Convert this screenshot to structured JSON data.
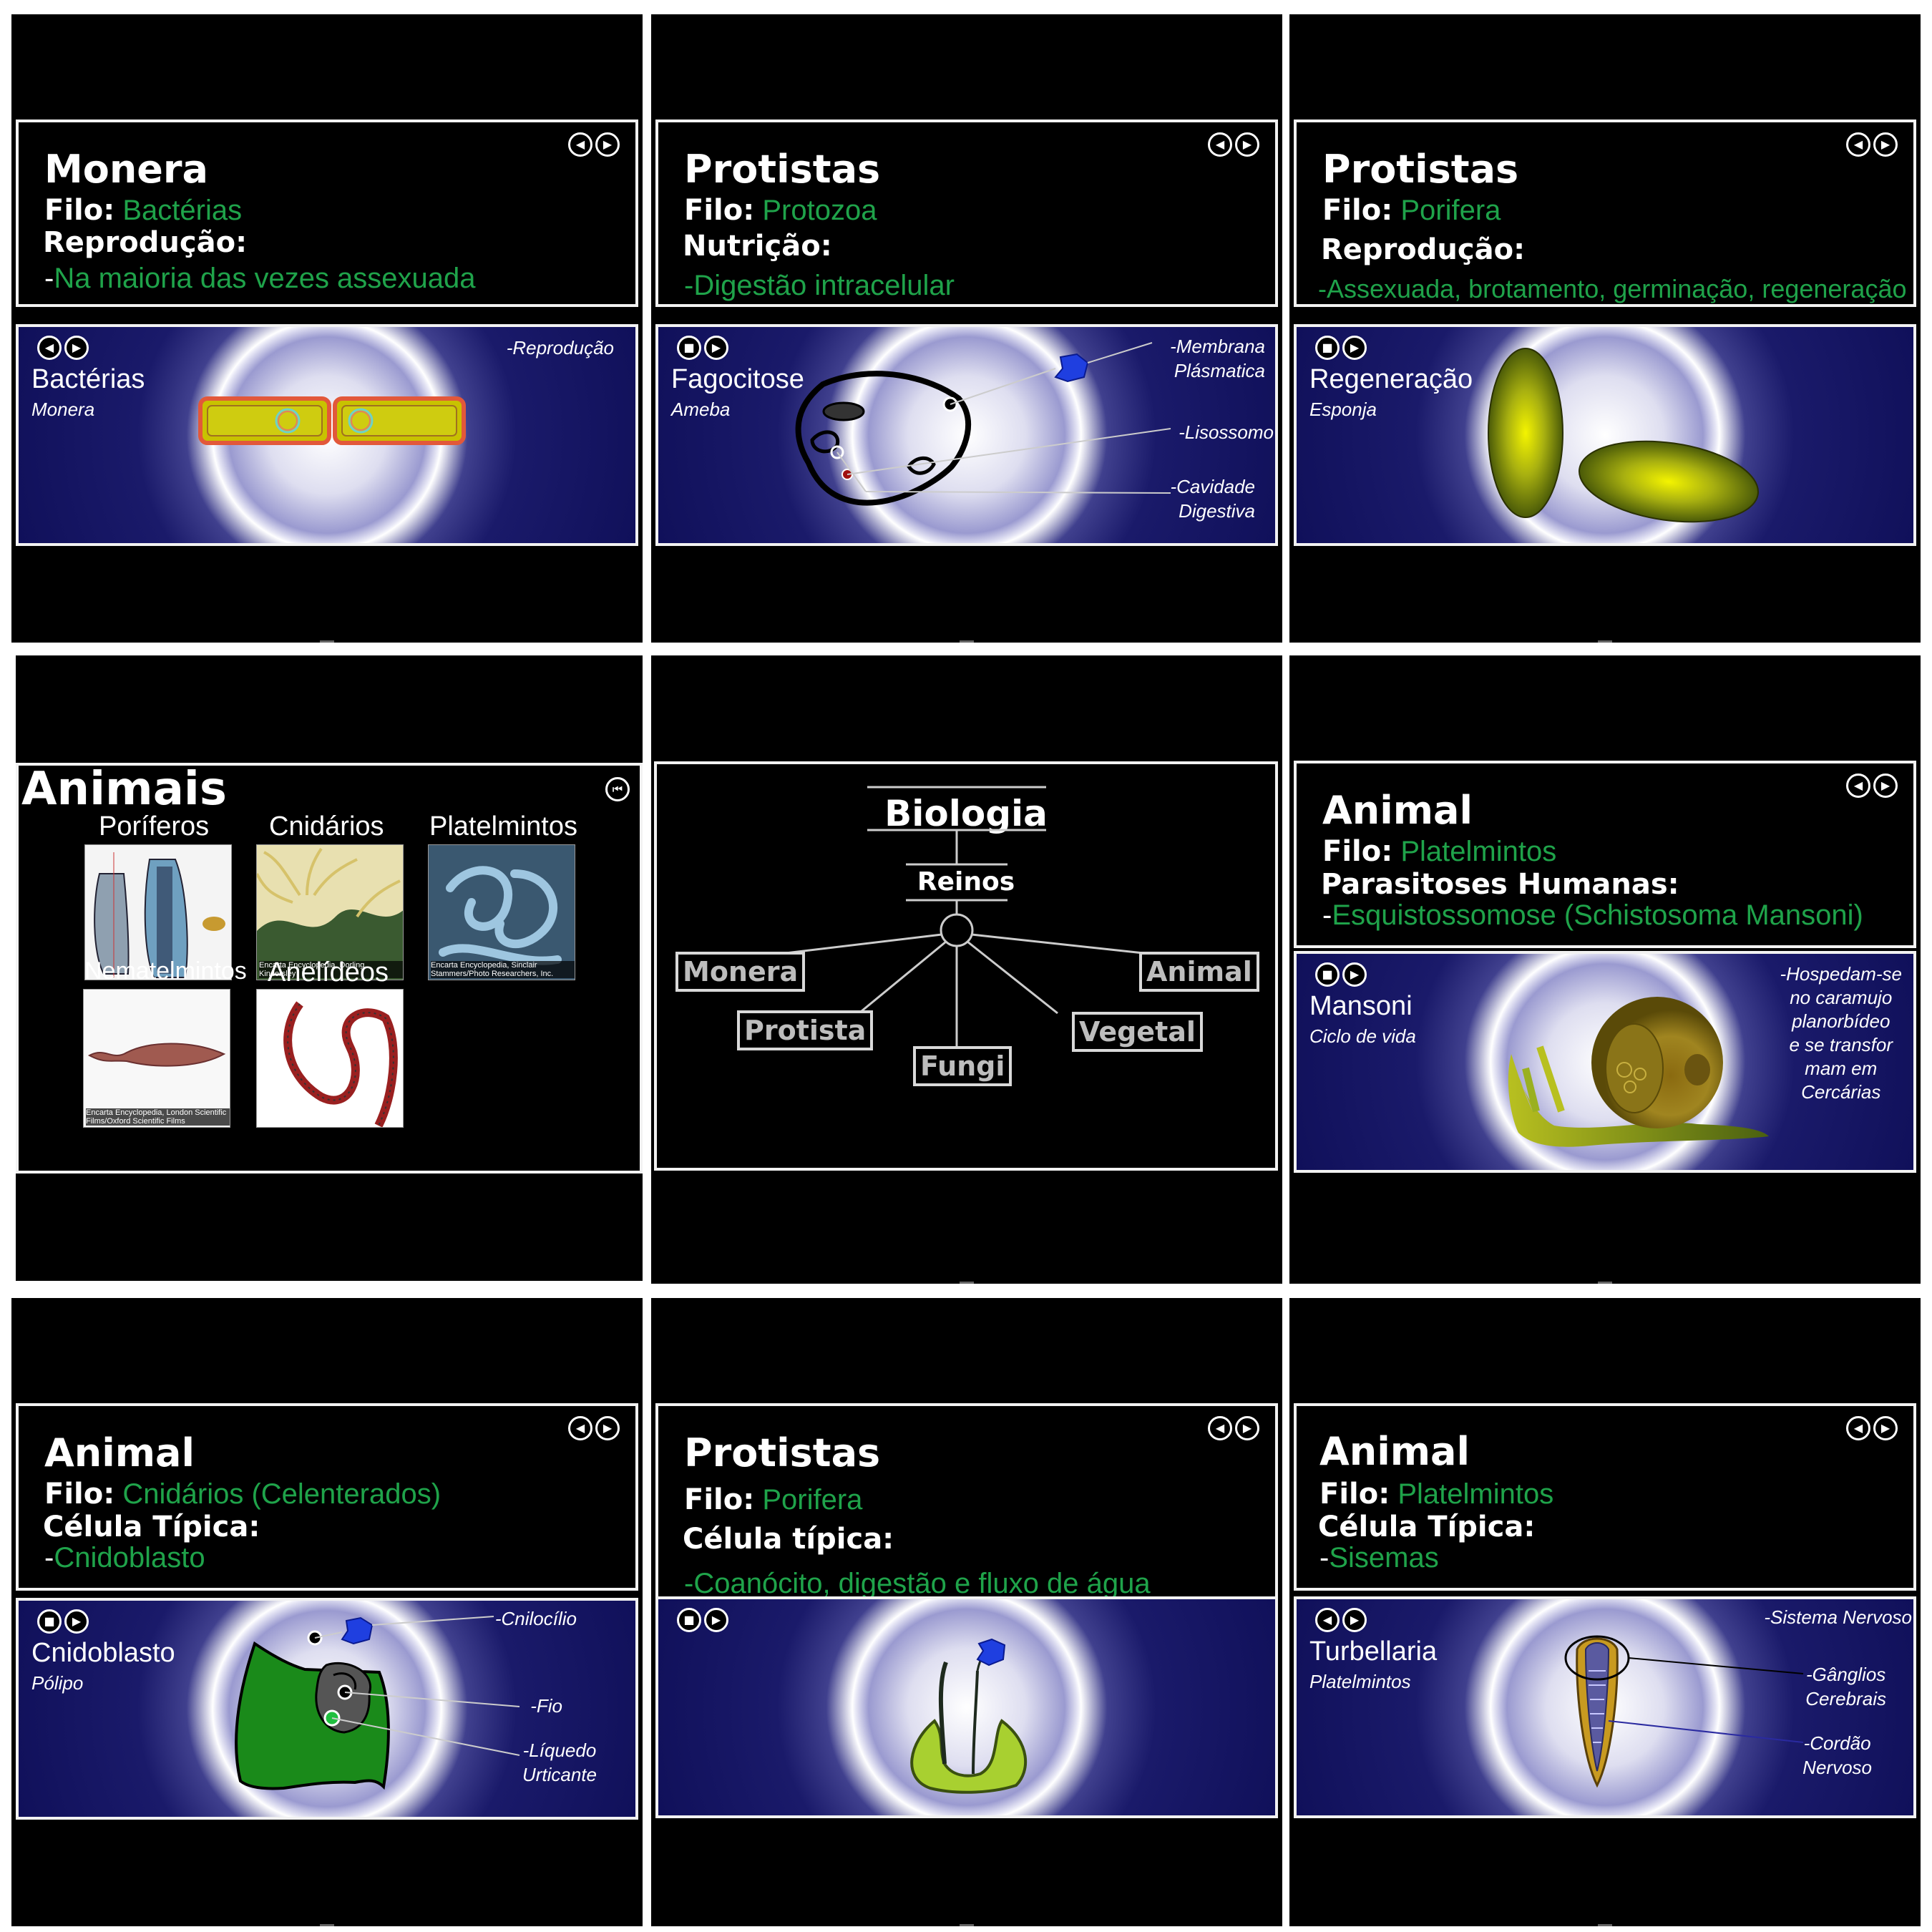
{
  "panels": {
    "p1": {
      "title": "Monera",
      "filo_label": "Filo:",
      "filo": "Bactérias",
      "heading": "Reprodução:",
      "dash": "-",
      "detail": "Na maioria das vezes assexuada",
      "scene_name": "Bactérias",
      "scene_sub": "Monera",
      "label1": "-Reprodução"
    },
    "p2": {
      "title": "Protistas",
      "filo_label": "Filo:",
      "filo": "Protozoa",
      "heading": "Nutrição:",
      "detail": "-Digestão intracelular",
      "scene_name": "Fagocitose",
      "scene_sub": "Ameba",
      "label1": "-Membrana\nPlásmatica",
      "label2": "-Lisossomo",
      "label3": "-Cavidade\nDigestiva"
    },
    "p3": {
      "title": "Protistas",
      "filo_label": "Filo:",
      "filo": "Porifera",
      "heading": "Reprodução:",
      "detail": "-Assexuada, brotamento, germinação, regeneração",
      "scene_name": "Regeneração",
      "scene_sub": "Esponja"
    },
    "p4": {
      "title": "Animais",
      "items": [
        {
          "caption": "Poríferos",
          "credit": ""
        },
        {
          "caption": "Cnidários",
          "credit": "Encarta Encyclopedia, Dorling Kindersley"
        },
        {
          "caption": "Platelmintos",
          "credit": "Encarta Encyclopedia, Sinclair Stammers/Photo Researchers, Inc."
        },
        {
          "caption": "Nematelmintos",
          "credit": "Encarta Encyclopedia, London Scientific Films/Oxford Scientific Films"
        },
        {
          "caption": "Anelídeos",
          "credit": ""
        }
      ]
    },
    "p5": {
      "title": "Biologia",
      "sub": "Reinos",
      "kingdoms": [
        "Monera",
        "Protista",
        "Fungi",
        "Vegetal",
        "Animal"
      ]
    },
    "p6": {
      "title": "Animal",
      "filo_label": "Filo:",
      "filo": "Platelmintos",
      "heading": "Parasitoses Humanas:",
      "dash": "-",
      "detail": "Esquistossomose (Schistosoma Mansoni)",
      "scene_name": "Mansoni",
      "scene_sub": "Ciclo de vida",
      "label1": "-Hospedam-se\nno caramujo\nplanorbídeo\ne se transfor\nmam em\nCercárias"
    },
    "p7": {
      "title": "Animal",
      "filo_label": "Filo:",
      "filo": "Cnidários (Celenterados)",
      "heading": "Célula Típica:",
      "dash": "-",
      "detail": "Cnidoblasto",
      "scene_name": "Cnidoblasto",
      "scene_sub": "Pólipo",
      "label1": "-Cnilocílio",
      "label2": "-Fio",
      "label3": "-Líquedo\nUrticante"
    },
    "p8": {
      "title": "Protistas",
      "filo_label": "Filo:",
      "filo": "Porifera",
      "heading": "Célula típica:",
      "detail": "-Coanócito, digestão e fluxo de água"
    },
    "p9": {
      "title": "Animal",
      "filo_label": "Filo:",
      "filo": "Platelmintos",
      "heading": "Célula Típica:",
      "dash": "-",
      "detail": "Sisemas",
      "scene_name": "Turbellaria",
      "scene_sub": "Platelmintos",
      "label1": "-Sistema Nervoso",
      "label2": "-Gânglios\nCerebrais",
      "label3": "-Cordão\nNervoso"
    }
  },
  "colors": {
    "accent_green": "#1fa34a",
    "scene_blue": "#1a1a6a"
  },
  "icons": [
    "prev-icon",
    "next-icon",
    "stop-icon",
    "first-icon"
  ]
}
